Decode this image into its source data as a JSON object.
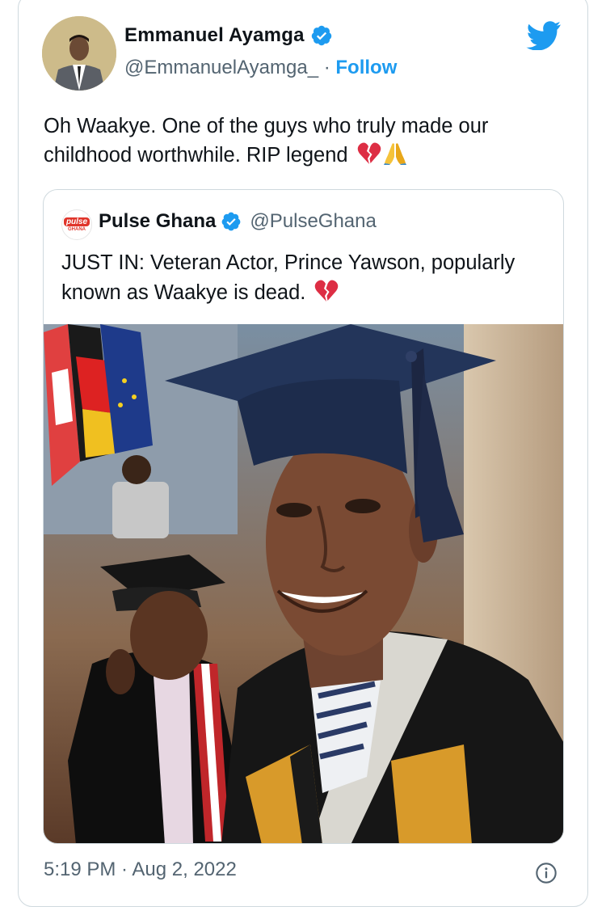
{
  "author": {
    "name": "Emmanuel Ayamga",
    "handle": "@EmmanuelAyamga_",
    "separator": " · ",
    "follow_label": "Follow"
  },
  "tweet": {
    "text": "Oh Waakye. One of the guys who truly made our childhood worthwhile. RIP legend",
    "emojis": [
      "broken-heart",
      "folded-hands"
    ]
  },
  "quoted_tweet": {
    "logo_text": "pulse",
    "logo_sub": "GHANA",
    "name": "Pulse Ghana",
    "handle": "@PulseGhana",
    "text": "JUST IN: Veteran Actor, Prince Yawson, popularly known as Waakye is dead.",
    "emoji": "broken-heart"
  },
  "footer": {
    "timestamp": "5:19 PM · Aug 2, 2022"
  },
  "colors": {
    "accent": "#1d9bf0",
    "text": "#0f1419",
    "muted": "#536471",
    "border": "#cfd9de"
  }
}
